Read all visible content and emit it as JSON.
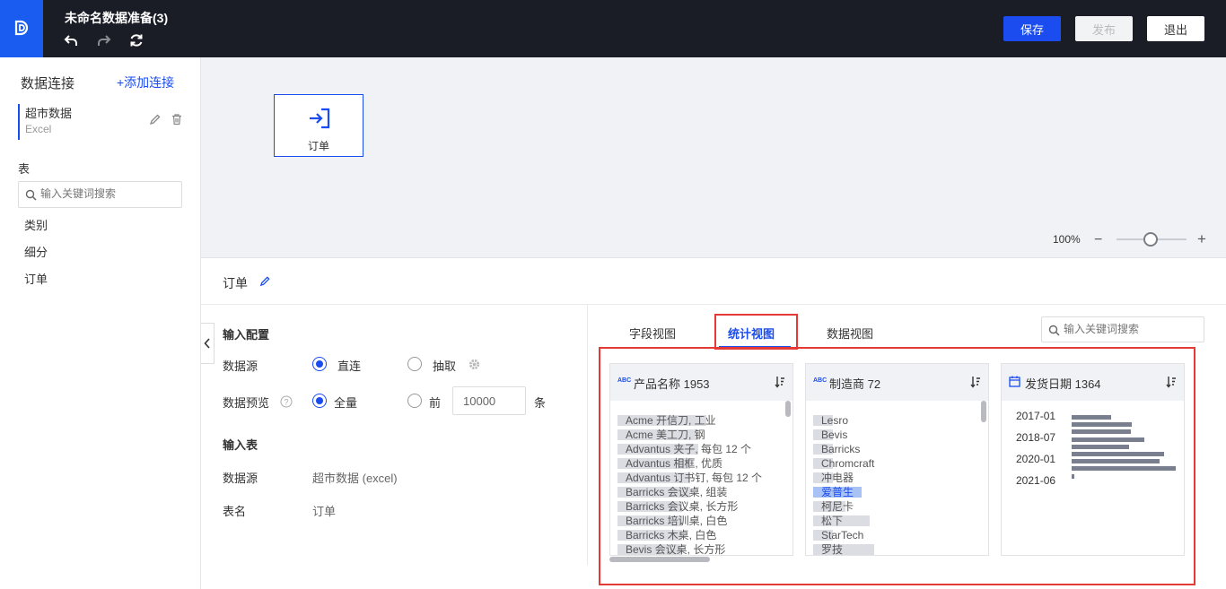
{
  "header": {
    "title": "未命名数据准备(3)",
    "save_label": "保存",
    "publish_label": "发布",
    "exit_label": "退出"
  },
  "sidebar": {
    "title": "数据连接",
    "add_label": "+添加连接",
    "connection": {
      "name": "超市数据",
      "type": "Excel"
    },
    "tables_title": "表",
    "search_placeholder": "输入关键词搜索",
    "tables": [
      "类别",
      "细分",
      "订单"
    ]
  },
  "canvas": {
    "node_label": "订单",
    "zoom": "100%"
  },
  "panel": {
    "title": "订单",
    "input_config_title": "输入配置",
    "datasource_label": "数据源",
    "opt_direct": "直连",
    "opt_extract": "抽取",
    "preview_label": "数据预览",
    "opt_full": "全量",
    "opt_front": "前",
    "front_value": "10000",
    "unit": "条",
    "input_table_title": "输入表",
    "ds_label": "数据源",
    "ds_value": "超市数据 (excel)",
    "table_label": "表名",
    "table_value": "订单"
  },
  "tabs": {
    "items": [
      "字段视图",
      "统计视图",
      "数据视图"
    ],
    "active": "统计视图",
    "search_placeholder": "输入关键词搜索"
  },
  "cards": [
    {
      "type_badge": "ABC",
      "name": "产品名称 1953",
      "rows": [
        {
          "label": "Acme 开信刀, 工业",
          "pct": 0.55
        },
        {
          "label": "Acme 美工刀, 钢",
          "pct": 0.5
        },
        {
          "label": "Advantus 夹子, 每包 12 个",
          "pct": 0.5
        },
        {
          "label": "Advantus 相框, 优质",
          "pct": 0.45
        },
        {
          "label": "Advantus 订书钉, 每包 12 个",
          "pct": 0.45
        },
        {
          "label": "Barricks 会议桌, 组装",
          "pct": 0.45
        },
        {
          "label": "Barricks 会议桌, 长方形",
          "pct": 0.4
        },
        {
          "label": "Barricks 培训桌, 白色",
          "pct": 0.4
        },
        {
          "label": "Barricks 木桌, 白色",
          "pct": 0.4
        },
        {
          "label": "Bevis 会议桌, 长方形",
          "pct": 0.4
        }
      ]
    },
    {
      "type_badge": "ABC",
      "name": "制造商 72",
      "rows": [
        {
          "label": "Lesro",
          "pct": 0.12
        },
        {
          "label": "Bevis",
          "pct": 0.12
        },
        {
          "label": "Barricks",
          "pct": 0.12
        },
        {
          "label": "Chromcraft",
          "pct": 0.12
        },
        {
          "label": "冲电器",
          "pct": 0.12
        },
        {
          "label": "爱普生",
          "pct": 0.3,
          "highlight": true
        },
        {
          "label": "柯尼卡",
          "pct": 0.2
        },
        {
          "label": "松下",
          "pct": 0.35
        },
        {
          "label": "StarTech",
          "pct": 0.12
        },
        {
          "label": "罗技",
          "pct": 0.38
        }
      ]
    },
    {
      "name": "发货日期 1364",
      "ticks": [
        "2017-01",
        "2018-07",
        "2020-01",
        "2021-06"
      ],
      "bars": [
        0.38,
        0.57,
        0.56,
        0.69,
        0.55,
        0.88,
        0.84,
        0.99,
        0.02
      ]
    }
  ]
}
